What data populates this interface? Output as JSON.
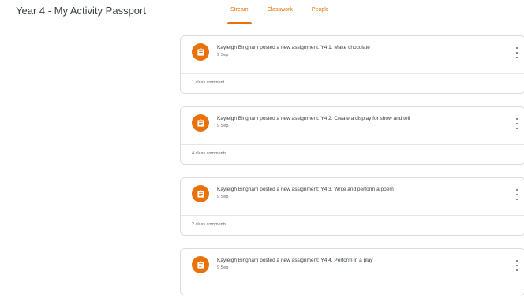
{
  "header": {
    "class_title": "Year 4 - My Activity Passport",
    "tabs": [
      {
        "label": "Stream",
        "active": true
      },
      {
        "label": "Classwork",
        "active": false
      },
      {
        "label": "People",
        "active": false
      }
    ]
  },
  "colors": {
    "accent": "#e8710a",
    "divider": "#dadce0",
    "text": "#3c4043",
    "muted": "#5f6368"
  },
  "stream": {
    "posts": [
      {
        "icon": "assignment-icon",
        "title": "Kayleigh Bingham posted a new assignment: Y4 1. Make chocolate",
        "date": "9 Sep",
        "comments": "1 class comment"
      },
      {
        "icon": "assignment-icon",
        "title": "Kayleigh Bingham posted a new assignment: Y4 2. Create a display for show and tell",
        "date": "9 Sep",
        "comments": "4 class comments"
      },
      {
        "icon": "assignment-icon",
        "title": "Kayleigh Bingham posted a new assignment: Y4 3. Write and perform a poem",
        "date": "9 Sep",
        "comments": "2 class comments"
      },
      {
        "icon": "assignment-icon",
        "title": "Kayleigh Bingham posted a new assignment: Y4 4. Perform in a play",
        "date": "9 Sep"
      }
    ]
  }
}
